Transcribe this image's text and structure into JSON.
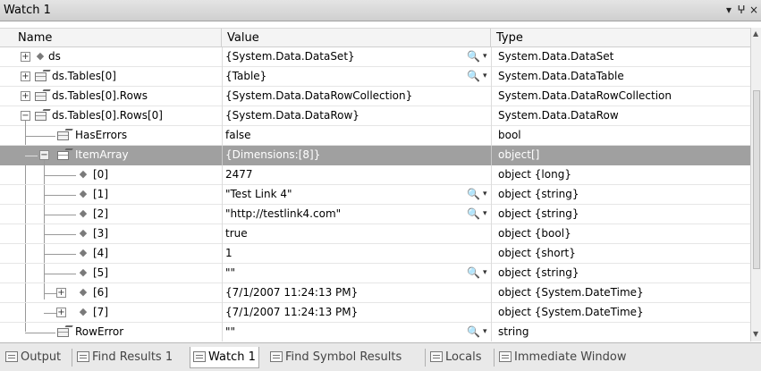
{
  "window": {
    "title": "Watch 1",
    "dropdown_glyph": "▾",
    "pin_glyph": "ⵖ",
    "close_glyph": "×"
  },
  "columns": {
    "name": "Name",
    "value": "Value",
    "type": "Type"
  },
  "rows": [
    {
      "name": "ds",
      "value": "{System.Data.DataSet}",
      "type": "System.Data.DataSet"
    },
    {
      "name": "ds.Tables[0]",
      "value": "{Table}",
      "type": "System.Data.DataTable"
    },
    {
      "name": "ds.Tables[0].Rows",
      "value": "{System.Data.DataRowCollection}",
      "type": "System.Data.DataRowCollection"
    },
    {
      "name": "ds.Tables[0].Rows[0]",
      "value": "{System.Data.DataRow}",
      "type": "System.Data.DataRow"
    },
    {
      "name": "HasErrors",
      "value": "false",
      "type": "bool"
    },
    {
      "name": "ItemArray",
      "value": "{Dimensions:[8]}",
      "type": "object[]"
    },
    {
      "name": "[0]",
      "value": "2477",
      "type": "object {long}"
    },
    {
      "name": "[1]",
      "value": "\"Test Link 4\"",
      "type": "object {string}"
    },
    {
      "name": "[2]",
      "value": "\"http://testlink4.com\"",
      "type": "object {string}"
    },
    {
      "name": "[3]",
      "value": "true",
      "type": "object {bool}"
    },
    {
      "name": "[4]",
      "value": "1",
      "type": "object {short}"
    },
    {
      "name": "[5]",
      "value": "\"\"",
      "type": "object {string}"
    },
    {
      "name": "[6]",
      "value": "{7/1/2007 11:24:13 PM}",
      "type": "object {System.DateTime}"
    },
    {
      "name": "[7]",
      "value": "{7/1/2007 11:24:13 PM}",
      "type": "object {System.DateTime}"
    },
    {
      "name": "RowError",
      "value": "\"\"",
      "type": "string"
    }
  ],
  "glyphs": {
    "expand": "+",
    "collapse": "−",
    "magnifier": "🔍",
    "value_dropdown": "▾",
    "field": "◆"
  },
  "tabs": [
    {
      "label": "Output",
      "icon": "output-icon"
    },
    {
      "label": "Find Results 1",
      "icon": "find-results-icon"
    },
    {
      "label": "Watch 1",
      "icon": "watch-icon"
    },
    {
      "label": "Find Symbol Results",
      "icon": "find-symbol-icon"
    },
    {
      "label": "Locals",
      "icon": "locals-icon"
    },
    {
      "label": "Immediate Window",
      "icon": "immediate-window-icon"
    }
  ],
  "colors": {
    "selected_row": "#a0a0a0",
    "header_bg": "#f4f4f4",
    "titlebar_bg": "#d8d8d8"
  }
}
